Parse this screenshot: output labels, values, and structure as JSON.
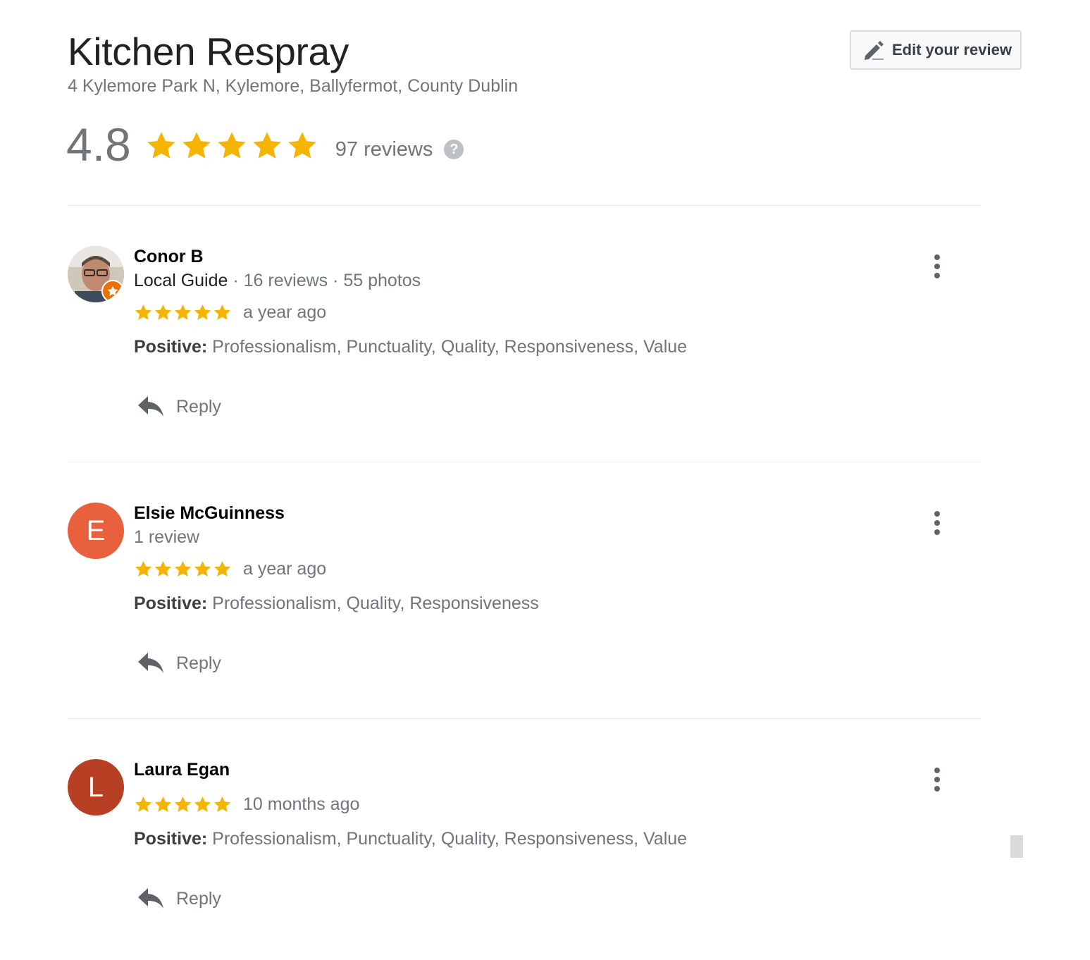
{
  "header": {
    "title": "Kitchen Respray",
    "address": "4 Kylemore Park N, Kylemore, Ballyfermot, County Dublin",
    "edit_button_label": "Edit your review",
    "edit_icon": "pencil-icon"
  },
  "summary": {
    "rating": "4.8",
    "stars": 4.8,
    "reviews_count": "97 reviews",
    "help_icon_glyph": "?"
  },
  "colors": {
    "star": "#f4b400",
    "avatar_elsie": "#e8603c",
    "avatar_laura": "#b73f23",
    "guide_badge": "#e8710a"
  },
  "reviews": [
    {
      "name": "Conor B",
      "guide_label": "Local Guide",
      "meta_rest": " · 16 reviews · 55 photos",
      "avatar_type": "photo",
      "stars": 5,
      "time": "a year ago",
      "positive_label": "Positive:",
      "positive_text": " Professionalism, Punctuality, Quality, Responsiveness, Value",
      "reply_label": "Reply"
    },
    {
      "name": "Elsie McGuinness",
      "meta": "1 review",
      "avatar_letter": "E",
      "stars": 5,
      "time": "a year ago",
      "positive_label": "Positive:",
      "positive_text": " Professionalism, Quality, Responsiveness",
      "reply_label": "Reply"
    },
    {
      "name": "Laura Egan",
      "avatar_letter": "L",
      "stars": 5,
      "time": "10 months ago",
      "positive_label": "Positive:",
      "positive_text": " Professionalism, Punctuality, Quality, Responsiveness, Value",
      "reply_label": "Reply"
    }
  ]
}
